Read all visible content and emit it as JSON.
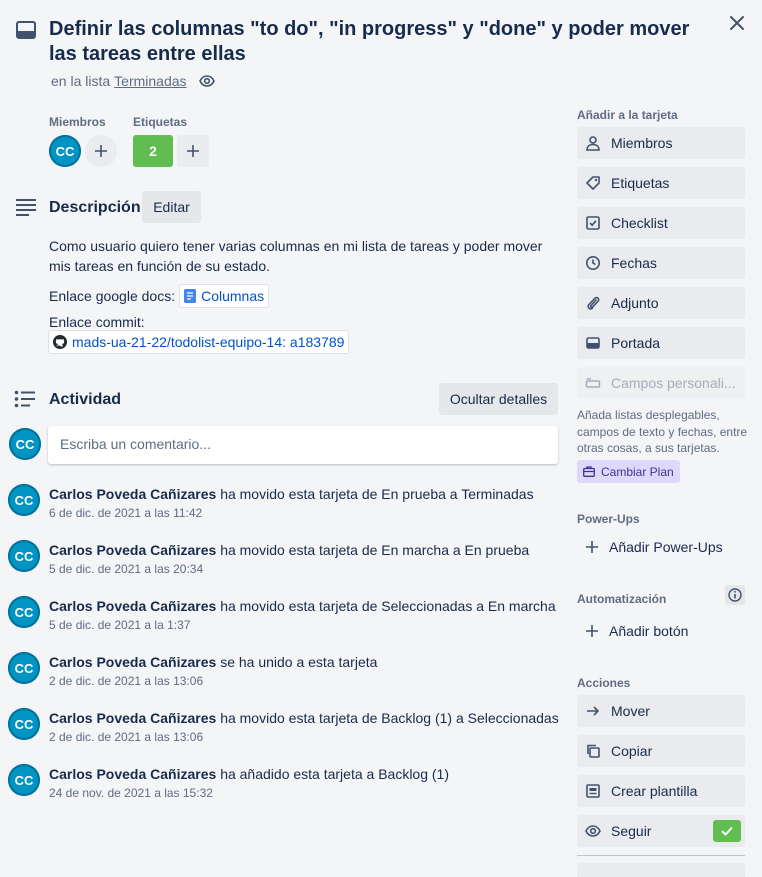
{
  "card": {
    "title": "Definir las columnas \"to do\", \"in progress\" y \"done\" y poder mover las tareas entre ellas",
    "list_prefix": "en la lista",
    "list_name": "Terminadas"
  },
  "members": {
    "label": "Miembros",
    "avatar": "CC"
  },
  "labels": {
    "label": "Etiquetas",
    "chip": "2",
    "chip_color": "#61bd4f"
  },
  "description": {
    "title": "Descripción",
    "edit_button": "Editar",
    "paragraph": "Como usuario quiero tener varias columnas en mi lista de tareas y poder mover mis tareas en función de su estado.",
    "docs_label": "Enlace google docs:",
    "docs_link": "Columnas",
    "commit_label": "Enlace commit:",
    "commit_link": "mads-ua-21-22/todolist-equipo-14: a183789"
  },
  "activity": {
    "title": "Actividad",
    "toggle_button": "Ocultar detalles",
    "comment_placeholder": "Escriba un comentario...",
    "user_avatar": "CC",
    "items": [
      {
        "avatar": "CC",
        "user": "Carlos Poveda Cañizares",
        "action": "ha movido esta tarjeta de En prueba a Terminadas",
        "date": "6 de dic. de 2021 a las 11:42"
      },
      {
        "avatar": "CC",
        "user": "Carlos Poveda Cañizares",
        "action": "ha movido esta tarjeta de En marcha a En prueba",
        "date": "5 de dic. de 2021 a las 20:34"
      },
      {
        "avatar": "CC",
        "user": "Carlos Poveda Cañizares",
        "action": "ha movido esta tarjeta de Seleccionadas a En marcha",
        "date": "5 de dic. de 2021 a la 1:37"
      },
      {
        "avatar": "CC",
        "user": "Carlos Poveda Cañizares",
        "action": "se ha unido a esta tarjeta",
        "date": "2 de dic. de 2021 a las 13:06"
      },
      {
        "avatar": "CC",
        "user": "Carlos Poveda Cañizares",
        "action": "ha movido esta tarjeta de Backlog (1) a Seleccionadas",
        "date": "2 de dic. de 2021 a las 13:06"
      },
      {
        "avatar": "CC",
        "user": "Carlos Poveda Cañizares",
        "action": "ha añadido esta tarjeta a Backlog (1)",
        "date": "24 de nov. de 2021 a las 15:32"
      }
    ]
  },
  "sidebar": {
    "add_title": "Añadir a la tarjeta",
    "add_items": [
      {
        "label": "Miembros",
        "icon": "person-icon"
      },
      {
        "label": "Etiquetas",
        "icon": "tag-icon"
      },
      {
        "label": "Checklist",
        "icon": "checklist-icon"
      },
      {
        "label": "Fechas",
        "icon": "clock-icon"
      },
      {
        "label": "Adjunto",
        "icon": "paperclip-icon"
      },
      {
        "label": "Portada",
        "icon": "cover-icon"
      }
    ],
    "custom_fields": "Campos personali...",
    "custom_fields_note": "Añada listas desplegables, campos de texto y fechas, entre otras cosas, a sus tarjetas.",
    "upgrade_button": "Cambiar Plan",
    "powerups_title": "Power-Ups",
    "powerups_add": "Añadir Power-Ups",
    "automation_title": "Automatización",
    "automation_add": "Añadir botón",
    "actions_title": "Acciones",
    "actions": [
      {
        "label": "Mover",
        "icon": "arrow-right-icon"
      },
      {
        "label": "Copiar",
        "icon": "copy-icon"
      },
      {
        "label": "Crear plantilla",
        "icon": "template-icon"
      },
      {
        "label": "Seguir",
        "icon": "eye-icon"
      }
    ]
  }
}
